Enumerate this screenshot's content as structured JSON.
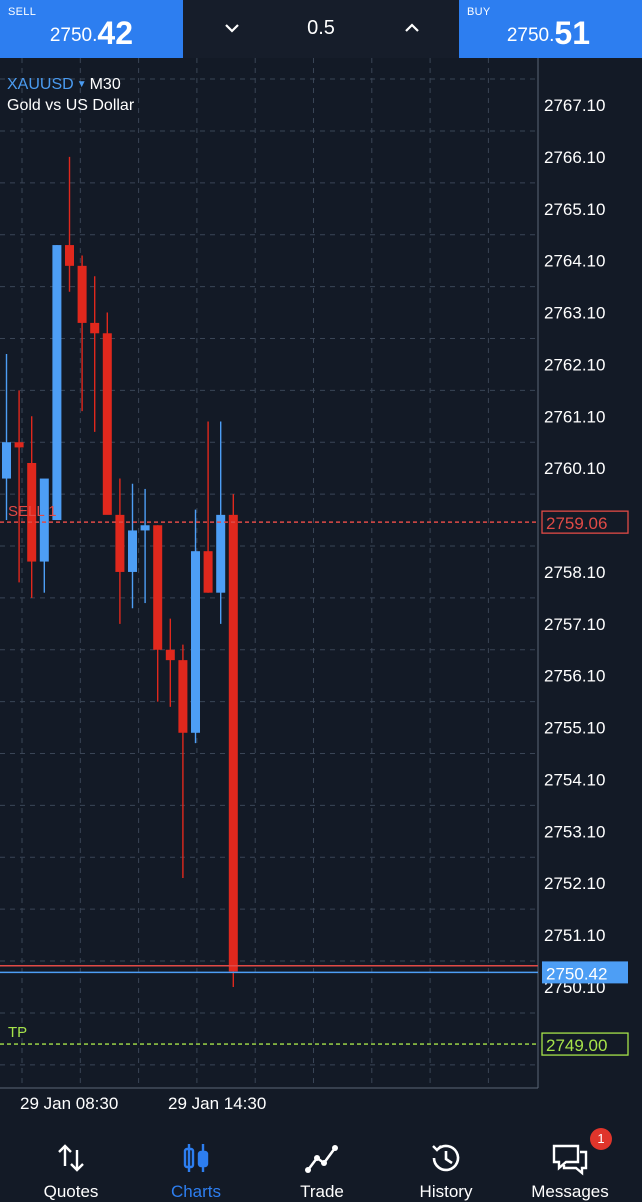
{
  "trade_bar": {
    "sell_label": "SELL",
    "sell_price_base": "2750.",
    "sell_price_big": "42",
    "buy_label": "BUY",
    "buy_price_base": "2750.",
    "buy_price_big": "51",
    "volume": "0.5"
  },
  "chart_header": {
    "symbol": "XAUUSD",
    "timeframe": "M30",
    "description": "Gold vs US Dollar"
  },
  "chart_data": {
    "type": "candlestick",
    "y_ticks": [
      "2767.10",
      "2766.10",
      "2765.10",
      "2764.10",
      "2763.10",
      "2762.10",
      "2761.10",
      "2760.10",
      "2758.10",
      "2757.10",
      "2756.10",
      "2755.10",
      "2754.10",
      "2753.10",
      "2752.10",
      "2751.10",
      "2750.10"
    ],
    "ylim": [
      2748.55,
      2767.7
    ],
    "x_labels": [
      "29 Jan 08:30",
      "29 Jan 14:30"
    ],
    "grid": true,
    "colors": {
      "bull": "#4d9ef5",
      "bear": "#e0281d",
      "sell_line": "#e04a46",
      "tp_line": "#a6e34a",
      "bid_line": "#4d9ef5",
      "ask_line": "#e04a46"
    },
    "candles": [
      {
        "o": 2759.9,
        "h": 2762.3,
        "l": 2759.1,
        "c": 2760.6
      },
      {
        "o": 2760.6,
        "h": 2761.6,
        "l": 2757.9,
        "c": 2760.5
      },
      {
        "o": 2760.2,
        "h": 2761.1,
        "l": 2757.6,
        "c": 2758.3
      },
      {
        "o": 2758.3,
        "h": 2759.5,
        "l": 2757.7,
        "c": 2759.9
      },
      {
        "o": 2759.1,
        "h": 2764.4,
        "l": 2759.1,
        "c": 2764.4
      },
      {
        "o": 2764.4,
        "h": 2766.1,
        "l": 2763.5,
        "c": 2764.0
      },
      {
        "o": 2764.0,
        "h": 2764.2,
        "l": 2761.2,
        "c": 2762.9
      },
      {
        "o": 2762.9,
        "h": 2763.8,
        "l": 2760.8,
        "c": 2762.7
      },
      {
        "o": 2762.7,
        "h": 2763.1,
        "l": 2759.6,
        "c": 2759.2
      },
      {
        "o": 2759.2,
        "h": 2759.9,
        "l": 2757.1,
        "c": 2758.1
      },
      {
        "o": 2758.1,
        "h": 2759.8,
        "l": 2757.4,
        "c": 2758.9
      },
      {
        "o": 2758.9,
        "h": 2759.7,
        "l": 2757.5,
        "c": 2759.0
      },
      {
        "o": 2759.0,
        "h": 2759.0,
        "l": 2755.6,
        "c": 2756.6
      },
      {
        "o": 2756.6,
        "h": 2757.2,
        "l": 2755.5,
        "c": 2756.4
      },
      {
        "o": 2756.4,
        "h": 2756.7,
        "l": 2752.2,
        "c": 2755.0
      },
      {
        "o": 2755.0,
        "h": 2759.3,
        "l": 2754.8,
        "c": 2758.5
      },
      {
        "o": 2758.5,
        "h": 2761.0,
        "l": 2757.7,
        "c": 2757.7
      },
      {
        "o": 2757.7,
        "h": 2761.0,
        "l": 2757.1,
        "c": 2759.2
      },
      {
        "o": 2759.2,
        "h": 2759.6,
        "l": 2750.1,
        "c": 2750.4
      }
    ],
    "levels": {
      "sell": {
        "label": "SELL 1",
        "price": 2759.06,
        "text": "2759.06"
      },
      "tp": {
        "label": "TP",
        "price": 2749.0,
        "text": "2749.00"
      },
      "ask": {
        "price": 2750.51
      },
      "bid": {
        "price": 2750.42,
        "text": "2750.42"
      }
    }
  },
  "nav": {
    "quotes": "Quotes",
    "charts": "Charts",
    "trade": "Trade",
    "history": "History",
    "messages": "Messages",
    "messages_badge": "1"
  }
}
